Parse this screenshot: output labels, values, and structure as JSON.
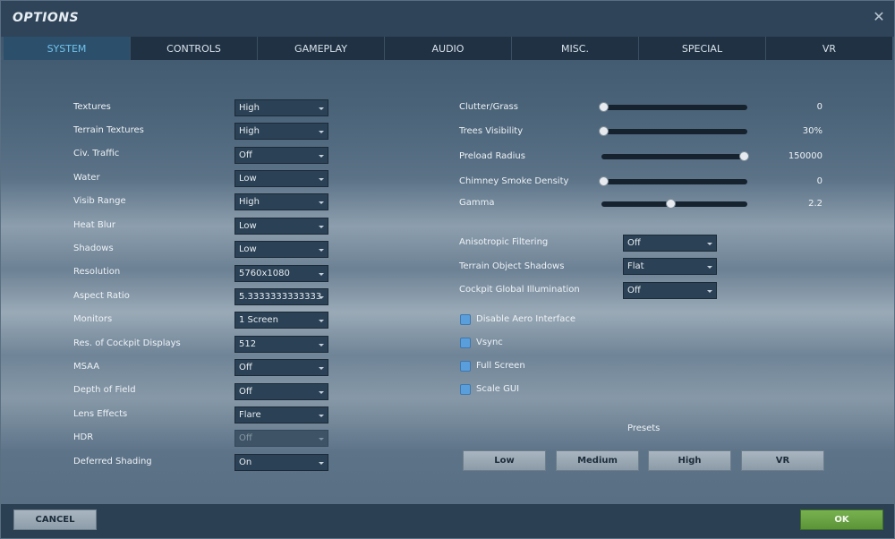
{
  "window": {
    "title": "OPTIONS"
  },
  "tabs": [
    {
      "label": "SYSTEM",
      "active": true
    },
    {
      "label": "CONTROLS",
      "active": false
    },
    {
      "label": "GAMEPLAY",
      "active": false
    },
    {
      "label": "AUDIO",
      "active": false
    },
    {
      "label": "MISC.",
      "active": false
    },
    {
      "label": "SPECIAL",
      "active": false
    },
    {
      "label": "VR",
      "active": false
    }
  ],
  "left_settings": [
    {
      "label": "Textures",
      "value": "High"
    },
    {
      "label": "Terrain Textures",
      "value": "High"
    },
    {
      "label": "Civ. Traffic",
      "value": "Off"
    },
    {
      "label": "Water",
      "value": "Low"
    },
    {
      "label": "Visib Range",
      "value": "High"
    },
    {
      "label": "Heat Blur",
      "value": "Low"
    },
    {
      "label": "Shadows",
      "value": "Low"
    },
    {
      "label": "Resolution",
      "value": "5760x1080"
    },
    {
      "label": "Aspect Ratio",
      "value": "5.3333333333333"
    },
    {
      "label": "Monitors",
      "value": "1 Screen"
    },
    {
      "label": "Res. of Cockpit Displays",
      "value": "512"
    },
    {
      "label": "MSAA",
      "value": "Off"
    },
    {
      "label": "Depth of Field",
      "value": "Off"
    },
    {
      "label": "Lens Effects",
      "value": "Flare"
    },
    {
      "label": "HDR",
      "value": "Off",
      "disabled": true
    },
    {
      "label": "Deferred Shading",
      "value": "On"
    }
  ],
  "sliders": [
    {
      "label": "Clutter/Grass",
      "value_text": "0",
      "fraction": 0.0
    },
    {
      "label": "Trees Visibility",
      "value_text": "30%",
      "fraction": 0.0
    },
    {
      "label": "Preload Radius",
      "value_text": "150000",
      "fraction": 1.0
    },
    {
      "label": "Chimney Smoke Density",
      "value_text": "0",
      "fraction": 0.0
    },
    {
      "label": "Gamma",
      "value_text": "2.2",
      "fraction": 0.48
    }
  ],
  "right_dropdowns": [
    {
      "label": "Anisotropic Filtering",
      "value": "Off"
    },
    {
      "label": "Terrain Object Shadows",
      "value": "Flat"
    },
    {
      "label": "Cockpit Global Illumination",
      "value": "Off"
    }
  ],
  "checkboxes": [
    {
      "label": "Disable Aero Interface",
      "checked": false
    },
    {
      "label": "Vsync",
      "checked": false
    },
    {
      "label": "Full Screen",
      "checked": false
    },
    {
      "label": "Scale GUI",
      "checked": false
    }
  ],
  "presets": {
    "title": "Presets",
    "buttons": [
      "Low",
      "Medium",
      "High",
      "VR"
    ]
  },
  "footer": {
    "cancel_label": "CANCEL",
    "ok_label": "OK"
  },
  "colors": {
    "active_tab_text": "#71c3ea",
    "ok_button": "#5f9a3c",
    "checkbox": "#5b9edc"
  }
}
